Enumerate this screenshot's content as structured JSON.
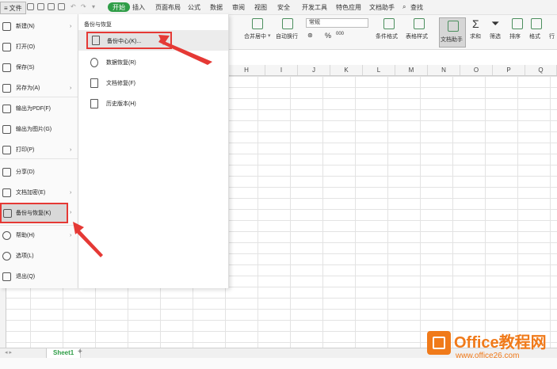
{
  "menubar": {
    "file_label": "文件",
    "tabs": [
      "开始",
      "插入",
      "页面布局",
      "公式",
      "数据",
      "审阅",
      "视图",
      "安全",
      "开发工具",
      "特色应用",
      "文档助手",
      "查找"
    ]
  },
  "ribbon": {
    "merge_center": "合并居中",
    "auto_wrap": "自动换行",
    "number_format": "常规",
    "cond_format": "条件格式",
    "table_style": "表格样式",
    "doc_helper": "文档助手",
    "sum": "求和",
    "filter": "筛选",
    "sort": "排序",
    "format": "格式",
    "rowcol": "行",
    "percent_symbol": "%",
    "thousands_symbol": "000"
  },
  "grid": {
    "columns": [
      "H",
      "I",
      "J",
      "K",
      "L",
      "M",
      "N",
      "O",
      "P",
      "Q"
    ]
  },
  "file_menu": {
    "items": [
      {
        "label": "新建(N)",
        "has_arrow": true
      },
      {
        "label": "打开(O)",
        "has_arrow": false
      },
      {
        "label": "保存(S)",
        "has_arrow": false
      },
      {
        "label": "另存为(A)",
        "has_arrow": true
      },
      {
        "label": "输出为PDF(F)",
        "has_arrow": false
      },
      {
        "label": "输出为图片(G)",
        "has_arrow": false
      },
      {
        "label": "打印(P)",
        "has_arrow": true
      },
      {
        "label": "分享(D)",
        "has_arrow": false
      },
      {
        "label": "文档加密(E)",
        "has_arrow": true
      },
      {
        "label": "备份与恢复(K)",
        "has_arrow": true
      },
      {
        "label": "帮助(H)",
        "has_arrow": true
      },
      {
        "label": "选项(L)",
        "has_arrow": false
      },
      {
        "label": "退出(Q)",
        "has_arrow": false
      }
    ]
  },
  "sub_menu": {
    "title": "备份与恢复",
    "items": [
      "备份中心(K)...",
      "数据恢复(R)",
      "文档修复(F)",
      "历史版本(H)"
    ]
  },
  "sheet": {
    "tab": "Sheet1",
    "add": "+"
  },
  "watermark": {
    "title": "Office教程网",
    "url": "www.office26.com"
  },
  "colors": {
    "accent_green": "#2f9d47",
    "highlight_red": "#e53935",
    "watermark_orange": "#f07a1a"
  }
}
